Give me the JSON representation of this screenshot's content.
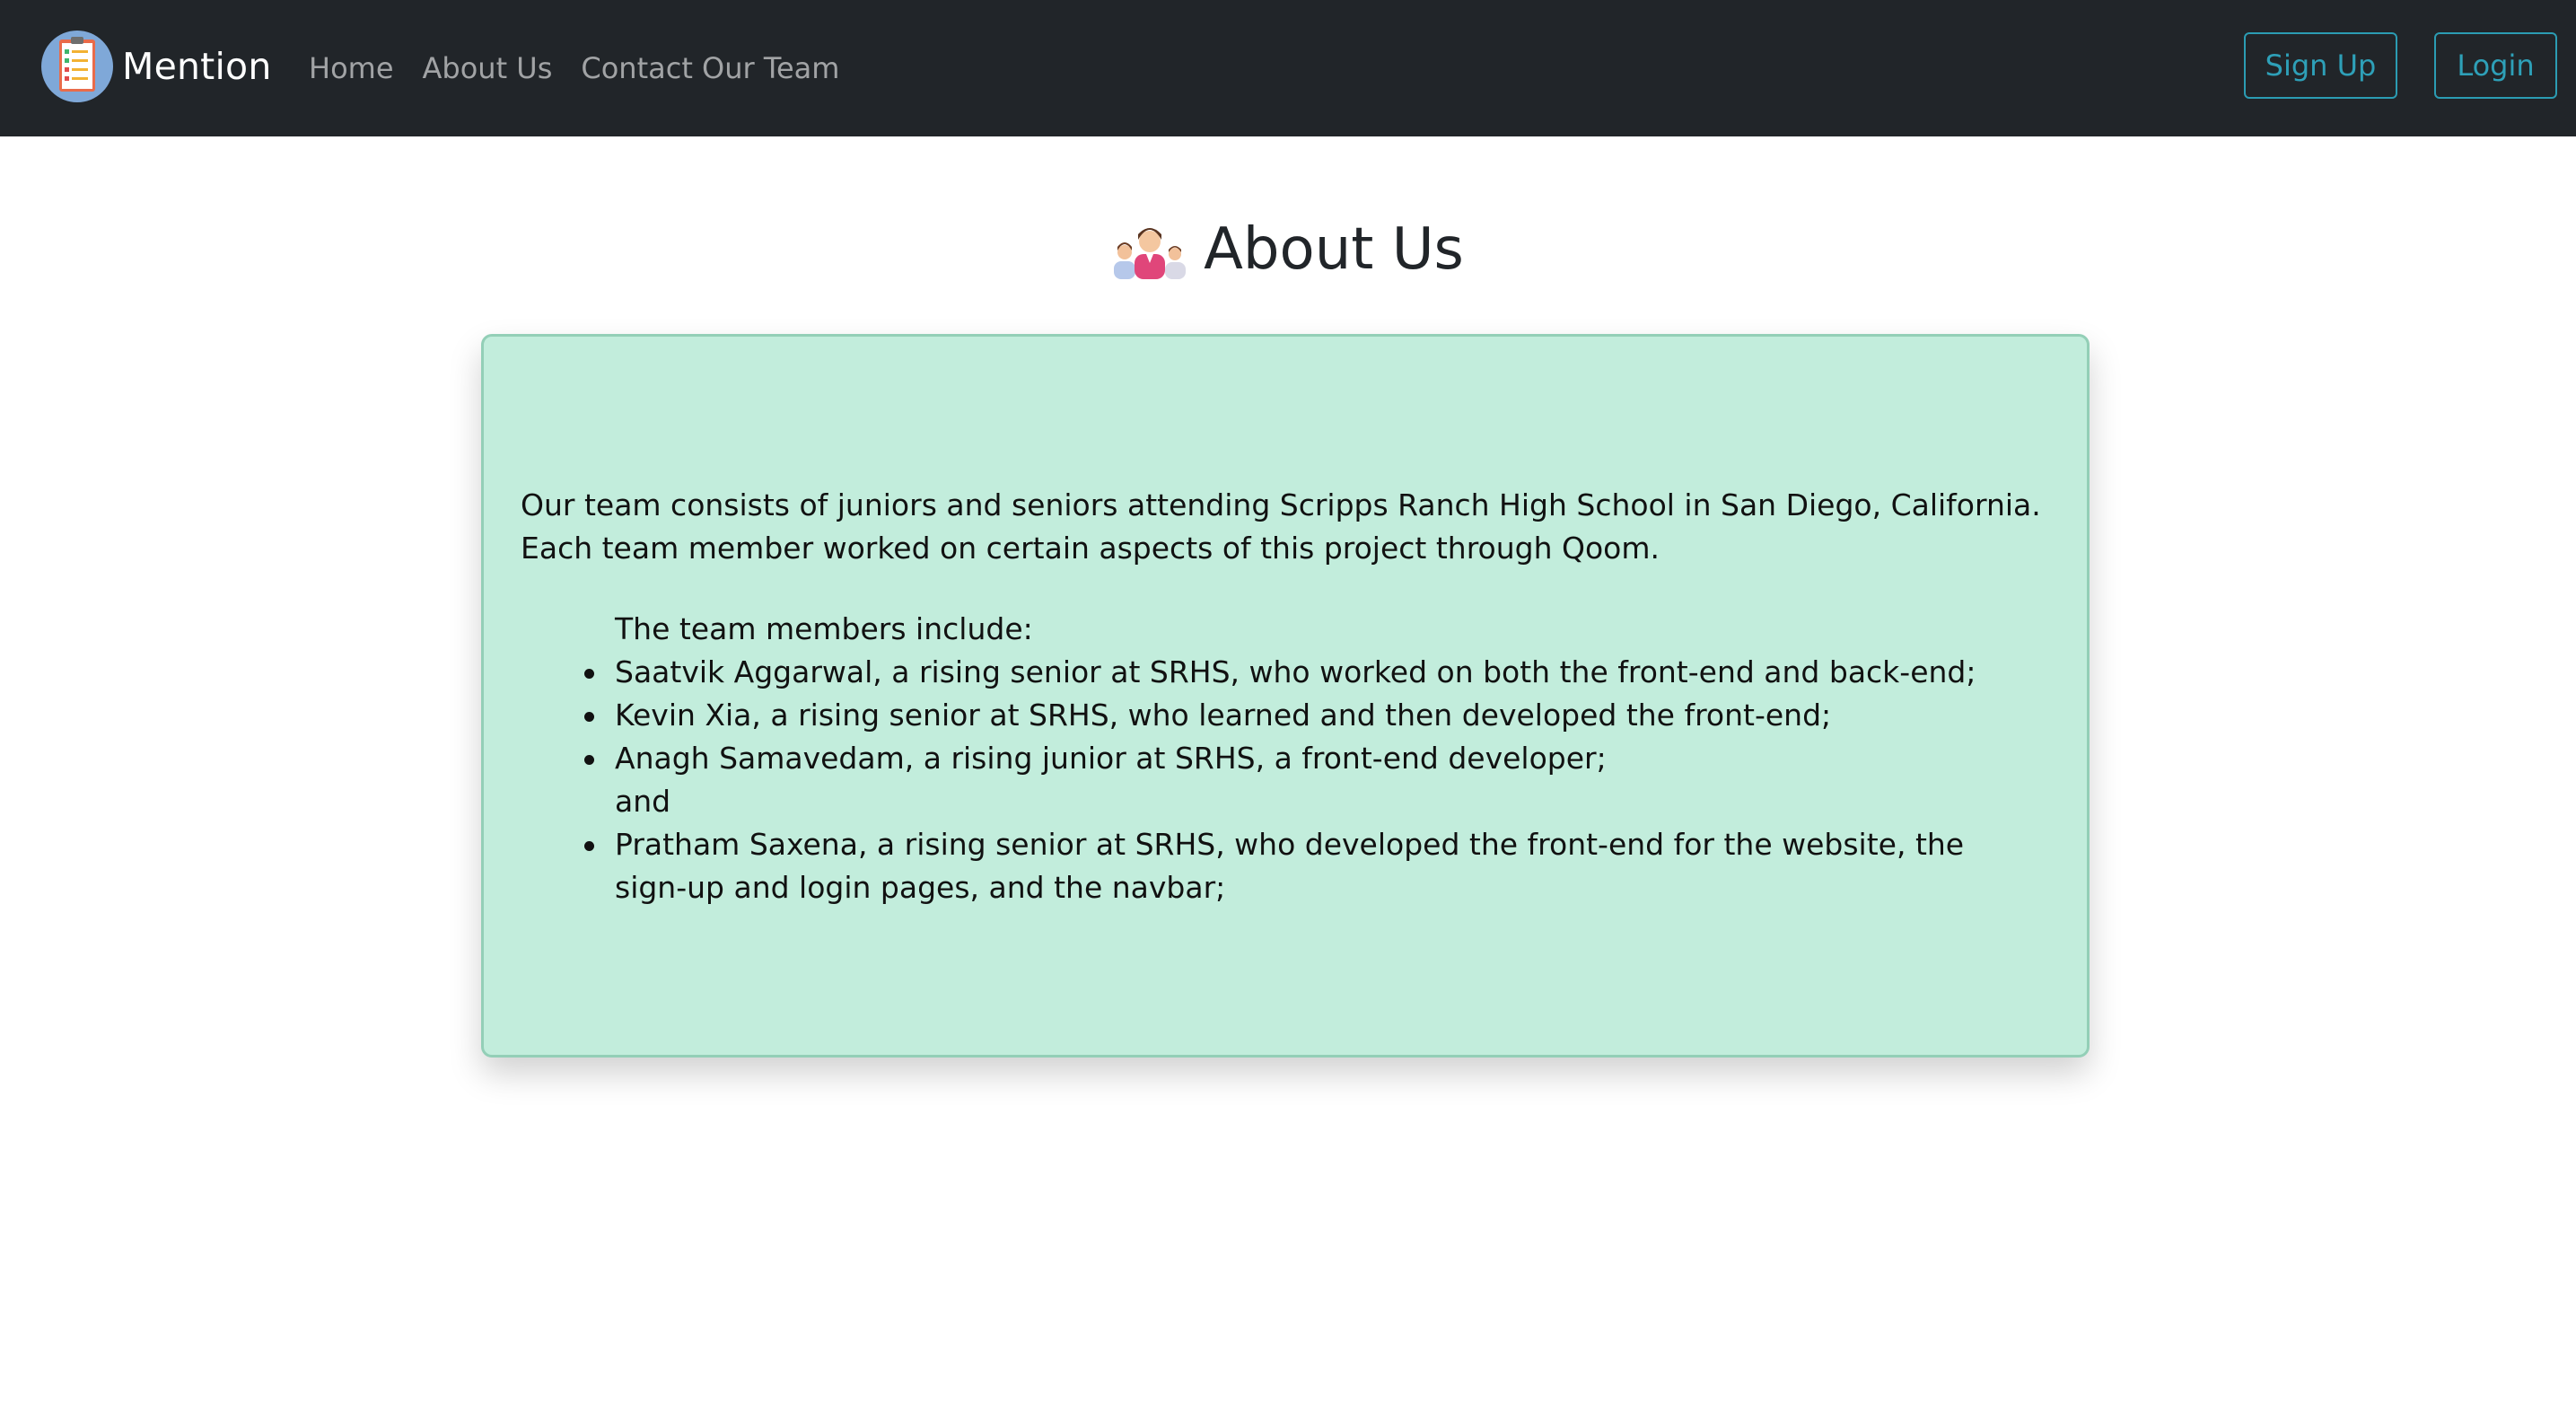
{
  "navbar": {
    "brand": "Mention",
    "links": [
      "Home",
      "About Us",
      "Contact Our Team"
    ],
    "signup_label": "Sign Up",
    "login_label": "Login"
  },
  "page": {
    "title": "About Us"
  },
  "card": {
    "intro": "Our team consists of juniors and seniors attending Scripps Ranch High School in San Diego, California. Each team member worked on certain aspects of this project through Qoom.",
    "members_title": "The team members include:",
    "members": [
      "Saatvik Aggarwal, a rising senior at SRHS, who worked on both the front-end and back-end;",
      "Kevin Xia, a rising senior at SRHS, who learned and then developed the front-end;",
      "Anagh Samavedam, a rising junior at SRHS, a front-end developer;",
      "Pratham Saxena, a rising senior at SRHS, who developed the front-end for the website, the sign-up and login pages, and the navbar;"
    ],
    "connector": "and"
  },
  "colors": {
    "navbar_bg": "#212529",
    "button_accent": "#2b9cb3",
    "card_bg": "#c2eddc",
    "card_border": "#93cfb7"
  },
  "icons": {
    "logo": "clipboard-checklist-icon",
    "heading": "team-people-icon"
  }
}
